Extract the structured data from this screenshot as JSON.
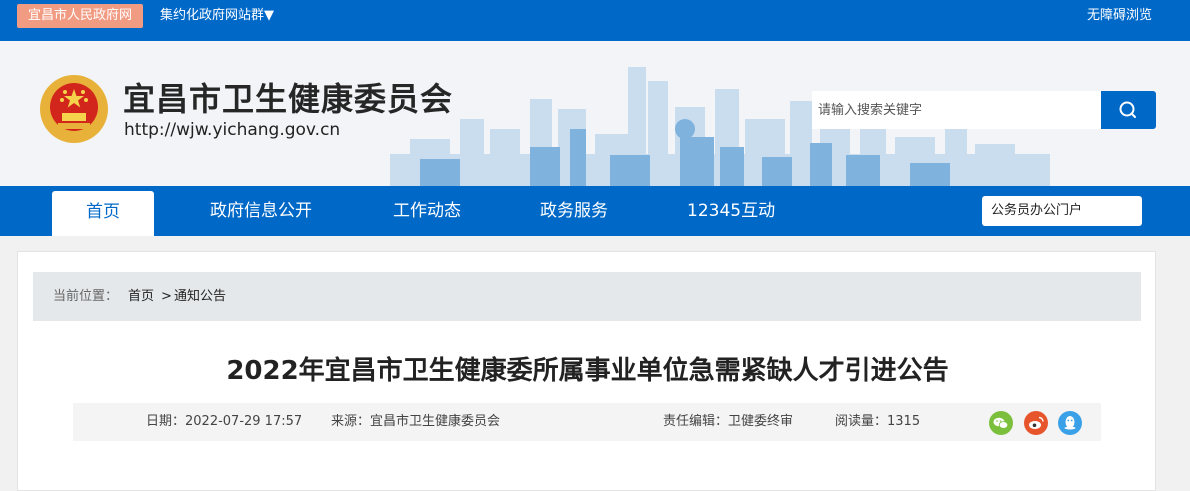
{
  "topbar": {
    "gov_link": "宜昌市人民政府网",
    "cluster": "集约化政府网站群",
    "cluster_caret": "▼",
    "accessibility": "无障碍浏览"
  },
  "header": {
    "title": "宜昌市卫生健康委员会",
    "url": "http://wjw.yichang.gov.cn",
    "search_placeholder": "请输入搜索关键字"
  },
  "nav": {
    "items": [
      "首页",
      "政府信息公开",
      "工作动态",
      "政务服务",
      "12345互动"
    ],
    "active_index": 0,
    "portal": "公务员办公门户"
  },
  "breadcrumb": {
    "label": "当前位置：",
    "home": "首页",
    "separator": ">",
    "current": "通知公告"
  },
  "article": {
    "title": "2022年宜昌市卫生健康委所属事业单位急需紧缺人才引进公告",
    "date": "日期：2022-07-29 17:57",
    "source": "来源：宜昌市卫生健康委员会",
    "editor": "责任编辑：卫健委终审",
    "views": "阅读量：1315"
  },
  "share": {
    "icons": [
      "wechat-icon",
      "weibo-icon",
      "qq-icon"
    ],
    "colors": [
      "#7bbf3c",
      "#e6552c",
      "#3aa0e8"
    ]
  },
  "colors": {
    "brand_blue": "#0069c8",
    "gov_link_bg": "#f19b83"
  }
}
